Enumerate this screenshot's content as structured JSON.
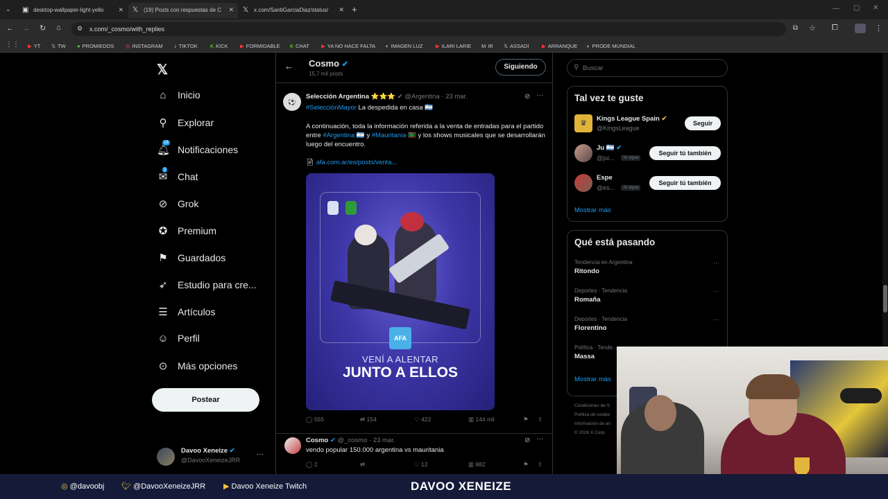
{
  "browser": {
    "tabs": [
      {
        "label": "desktop-wallpaper-light-yello",
        "icon": "image-tab-icon"
      },
      {
        "label": "(19) Posts con respuestas de C",
        "icon": "x-logo-icon"
      },
      {
        "label": "x.com/SantiGarciaDiaz/status/",
        "icon": "x-logo-icon"
      }
    ],
    "url": "x.com/_cosmo/with_replies",
    "bookmarks": [
      "YT",
      "TW",
      "PROMIEDOS",
      "INSTAGRAM",
      "TIKTOK",
      "KICK",
      "FORMIDABLE",
      "CHAT",
      "YA NO HACE FALTA",
      "IMAGEN LUZ",
      "ILARI LARIE",
      "IR",
      "ASSADI",
      "ARRANQUE",
      "PRODE MUNDIAL"
    ]
  },
  "sidebar": {
    "items": [
      {
        "label": "Inicio",
        "icon": "home-icon"
      },
      {
        "label": "Explorar",
        "icon": "search-icon"
      },
      {
        "label": "Notificaciones",
        "icon": "bell-icon",
        "badge": "18"
      },
      {
        "label": "Chat",
        "icon": "mail-icon",
        "badge": "1"
      },
      {
        "label": "Grok",
        "icon": "grok-icon"
      },
      {
        "label": "Premium",
        "icon": "verified-icon"
      },
      {
        "label": "Guardados",
        "icon": "bookmark-icon"
      },
      {
        "label": "Estudio para cre...",
        "icon": "rocket-icon"
      },
      {
        "label": "Artículos",
        "icon": "article-icon"
      },
      {
        "label": "Perfil",
        "icon": "person-icon"
      },
      {
        "label": "Más opciones",
        "icon": "more-circle-icon"
      }
    ],
    "post_button": "Postear",
    "account": {
      "name": "Davoo Xeneize",
      "handle": "@DavooXeneizeJRR"
    }
  },
  "header": {
    "name": "Cosmo",
    "subtitle": "15,7 mil posts",
    "follow_label": "Siguiendo"
  },
  "tweet1": {
    "author": "Selección Argentina ⭐⭐⭐",
    "handle": "@Argentina",
    "date": "· 23 mar.",
    "hashtag": "#SelecciónMayor",
    "line1": " La despedida en casa 🇦🇷",
    "body_a": "A continuación, toda la información referida a la venta de entradas para el partido entre ",
    "tag_arg": "#Argentina",
    "body_b": " 🇦🇷 y ",
    "tag_mau": "#Mauritania",
    "body_c": " 🇲🇷 y los shows musicales que se desarrollarán luego del encuentro.",
    "link": "afa.com.ar/es/posts/venta...",
    "media_line1": "VENÍ A ALENTAR",
    "media_line2": "JUNTO A ELLOS",
    "media_badge": "AFA",
    "stats": {
      "replies": "555",
      "retweets": "154",
      "likes": "422",
      "views": "144 mil"
    }
  },
  "tweet2": {
    "author": "Cosmo",
    "handle": "@_cosmo",
    "date": "· 23 mar.",
    "text": "vendo popular 150.000 argentina vs mauritania",
    "stats": {
      "replies": "2",
      "retweets": "",
      "likes": "12",
      "views": "882"
    }
  },
  "right": {
    "search_placeholder": "Buscar",
    "suggest_title": "Tal vez te guste",
    "suggestions": [
      {
        "name": "Kings League Spain",
        "handle": "@KingsLeague",
        "button": "Seguir"
      },
      {
        "name": "Ju 🇦🇷",
        "handle": "@jui...",
        "tag": "Te sigue",
        "button": "Seguir tú también"
      },
      {
        "name": "Espe",
        "handle": "@es...",
        "tag": "Te sigue",
        "button": "Seguir tú también"
      }
    ],
    "show_more": "Mostrar más",
    "trends_title": "Qué está pasando",
    "trends": [
      {
        "context": "Tendencia en Argentina",
        "name": "Ritondo"
      },
      {
        "context": "Deportes · Tendencia",
        "name": "Romaña"
      },
      {
        "context": "Deportes · Tendencia",
        "name": "Florentino"
      },
      {
        "context": "Política · Tende...",
        "name": "Massa"
      }
    ],
    "trends_more": "Mostrar más",
    "footer_links": [
      "Condiciones de S",
      "Política de cookie",
      "Información de an",
      "© 2026 X Corp."
    ]
  },
  "stream_footer": {
    "instagram": "@davoobj",
    "twitter": "@DavooXeneizeJRR",
    "youtube": "Davoo Xeneize Twitch",
    "brand": "DAVOO XENEIZE"
  },
  "colors": {
    "accent": "#1d9bf0",
    "bg": "#000000",
    "footer": "#141a38"
  }
}
